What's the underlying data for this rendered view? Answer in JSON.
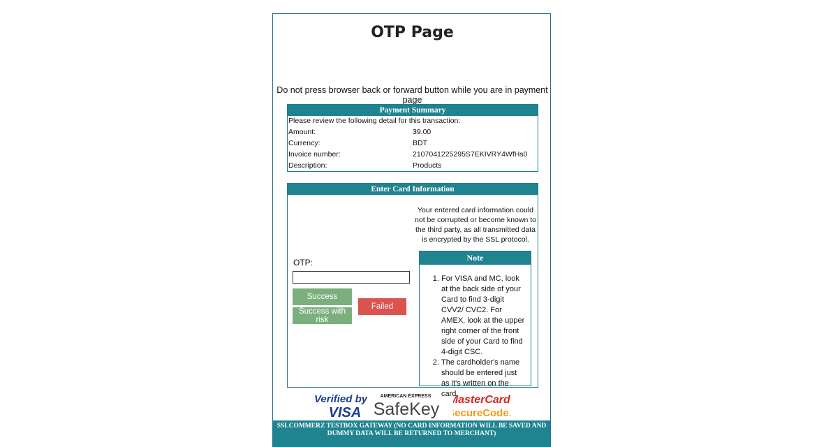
{
  "page": {
    "title": "OTP Page",
    "warning": "Do not press browser back or forward button while you are in payment page"
  },
  "summary": {
    "header": "Payment Summary",
    "intro": "Please review the following detail for this transaction:",
    "rows": [
      {
        "label": "Amount:",
        "value": "39.00"
      },
      {
        "label": "Currency:",
        "value": "BDT"
      },
      {
        "label": "Invoice number:",
        "value": "2107041225295S7EKIVRY4WfHs0"
      },
      {
        "label": "Description:",
        "value": "Products"
      }
    ]
  },
  "card": {
    "header": "Enter Card Information",
    "secure_text": "Your entered card information could not be corrupted or become known to the third party, as all transmitted data is encrypted by the SSL protocol.",
    "otp_label": "OTP:",
    "otp_value": "",
    "success_label": "Success",
    "success_risk_label": "Success with risk",
    "failed_label": "Failed"
  },
  "note": {
    "header": "Note",
    "items": [
      "For VISA and MC, look at the back side of your Card to find 3-digit CVV2/ CVC2. For AMEX, look at the upper right corner of the front side of your Card to find 4-digit CSC.",
      "The cardholder's name should be entered just as it's written on the card."
    ]
  },
  "logos": {
    "visa_line1": "Verified by",
    "visa_line2": "VISA",
    "amex_line1": "AMERICAN EXPRESS",
    "amex_line2": "SafeKey",
    "mc_line1": "MasterCard.",
    "mc_line2": "SecureCode."
  },
  "footer": {
    "text": "SSLCOMMERZ TESTBOX GATEWAY (NO CARD INFORMATION WILL BE SAVED AND DUMMY DATA WILL BE RETURNED TO MERCHANT)"
  },
  "colors": {
    "accent": "#1f8490",
    "success": "#7bb07e",
    "failed": "#d9534f"
  }
}
